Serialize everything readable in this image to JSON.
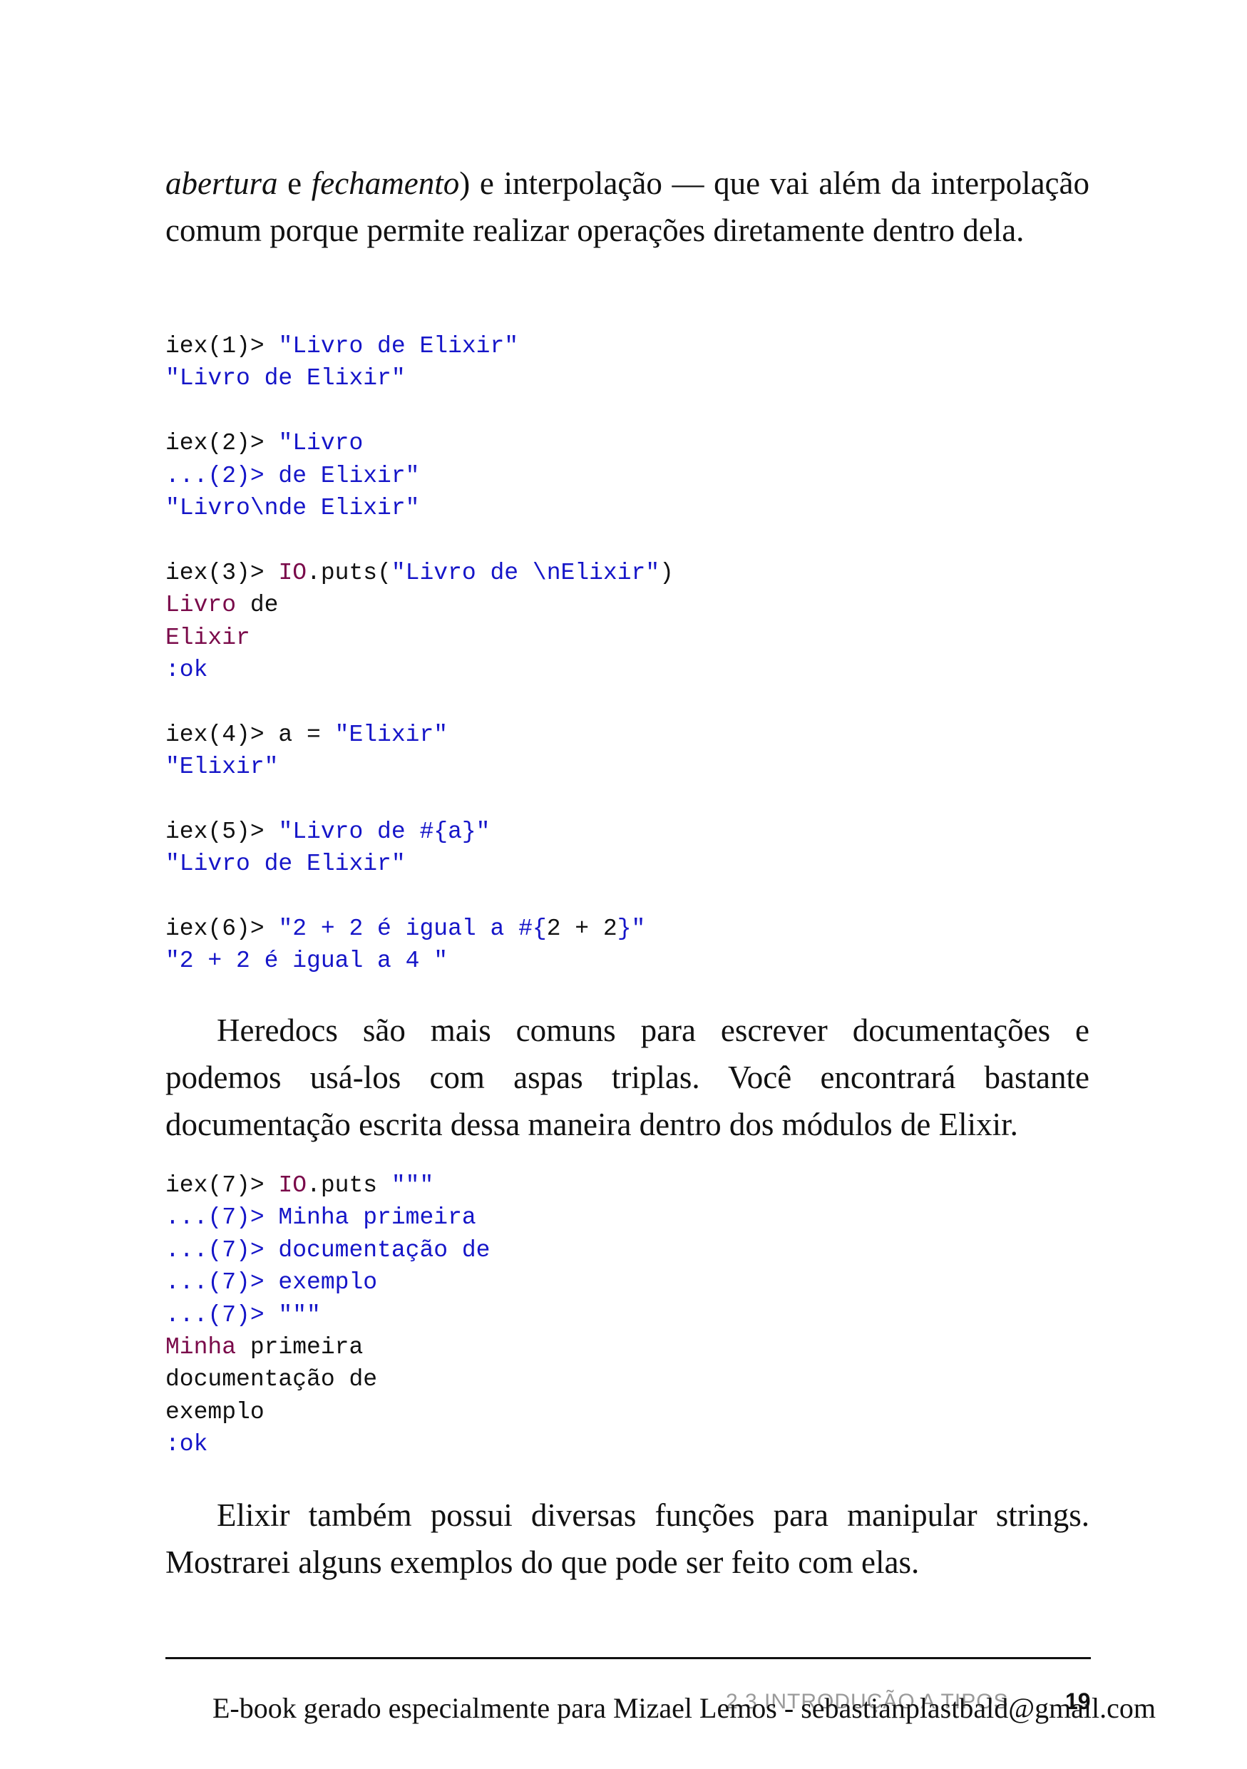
{
  "paragraph_1": {
    "italic_1": "abertura",
    "text_1": " e ",
    "italic_2": "fechamento",
    "text_2": ") e interpolação — que vai além da interpolação comum porque permite realizar operações diretamente dentro dela."
  },
  "code_1": [
    [
      {
        "t": "iex(1)> ",
        "c": "plain"
      },
      {
        "t": "\"Livro de Elixir\"",
        "c": "str"
      }
    ],
    [
      {
        "t": "\"Livro de Elixir\"",
        "c": "str"
      }
    ],
    [],
    [
      {
        "t": "iex(2)> ",
        "c": "plain"
      },
      {
        "t": "\"Livro",
        "c": "str"
      }
    ],
    [
      {
        "t": "...(2)> de Elixir\"",
        "c": "str"
      }
    ],
    [
      {
        "t": "\"Livro\\nde Elixir\"",
        "c": "str"
      }
    ],
    [],
    [
      {
        "t": "iex(3)> ",
        "c": "plain"
      },
      {
        "t": "IO",
        "c": "mod"
      },
      {
        "t": ".puts(",
        "c": "plain"
      },
      {
        "t": "\"Livro de \\nElixir\"",
        "c": "str"
      },
      {
        "t": ")",
        "c": "plain"
      }
    ],
    [
      {
        "t": "Livro",
        "c": "mod"
      },
      {
        "t": " de",
        "c": "plain"
      }
    ],
    [
      {
        "t": "Elixir",
        "c": "mod"
      }
    ],
    [
      {
        "t": ":ok",
        "c": "str"
      }
    ],
    [],
    [
      {
        "t": "iex(4)> a = ",
        "c": "plain"
      },
      {
        "t": "\"Elixir\"",
        "c": "str"
      }
    ],
    [
      {
        "t": "\"Elixir\"",
        "c": "str"
      }
    ],
    [],
    [
      {
        "t": "iex(5)> ",
        "c": "plain"
      },
      {
        "t": "\"Livro de #{a}\"",
        "c": "str"
      }
    ],
    [
      {
        "t": "\"Livro de Elixir\"",
        "c": "str"
      }
    ],
    [],
    [
      {
        "t": "iex(6)> ",
        "c": "plain"
      },
      {
        "t": "\"2 + 2 é igual a #{",
        "c": "str"
      },
      {
        "t": "2 + 2",
        "c": "plain"
      },
      {
        "t": "}\"",
        "c": "str"
      }
    ],
    [
      {
        "t": "\"2 + 2 é igual a 4 \"",
        "c": "str"
      }
    ]
  ],
  "paragraph_2": "Heredocs são mais comuns para escrever documentações e podemos usá-los com aspas triplas. Você encontrará bastante documentação escrita dessa maneira dentro dos módulos de Elixir.",
  "code_2": [
    [
      {
        "t": "iex(7)> ",
        "c": "plain"
      },
      {
        "t": "IO",
        "c": "mod"
      },
      {
        "t": ".puts ",
        "c": "plain"
      },
      {
        "t": "\"\"\"",
        "c": "str"
      }
    ],
    [
      {
        "t": "...(7)> Minha primeira",
        "c": "str"
      }
    ],
    [
      {
        "t": "...(7)> documentação de",
        "c": "str"
      }
    ],
    [
      {
        "t": "...(7)> exemplo",
        "c": "str"
      }
    ],
    [
      {
        "t": "...(7)> \"\"\"",
        "c": "str"
      }
    ],
    [
      {
        "t": "Minha",
        "c": "mod"
      },
      {
        "t": " primeira",
        "c": "plain"
      }
    ],
    [
      {
        "t": "documentação de",
        "c": "plain"
      }
    ],
    [
      {
        "t": "exemplo",
        "c": "plain"
      }
    ],
    [
      {
        "t": ":ok",
        "c": "str"
      }
    ]
  ],
  "paragraph_3": "Elixir também possui diversas funções para manipular strings. Mostrarei alguns exemplos do que pode ser feito com elas.",
  "footer": {
    "running_head": "2.3 INTRODUÇÃO A TIPOS",
    "page_number": "19",
    "watermark": "E-book gerado especialmente para Mizael Lemos - sebastianplastbald@gmail.com"
  },
  "colors": {
    "string": "#1515c8",
    "module": "#7a0a4a",
    "plain": "#111111"
  }
}
